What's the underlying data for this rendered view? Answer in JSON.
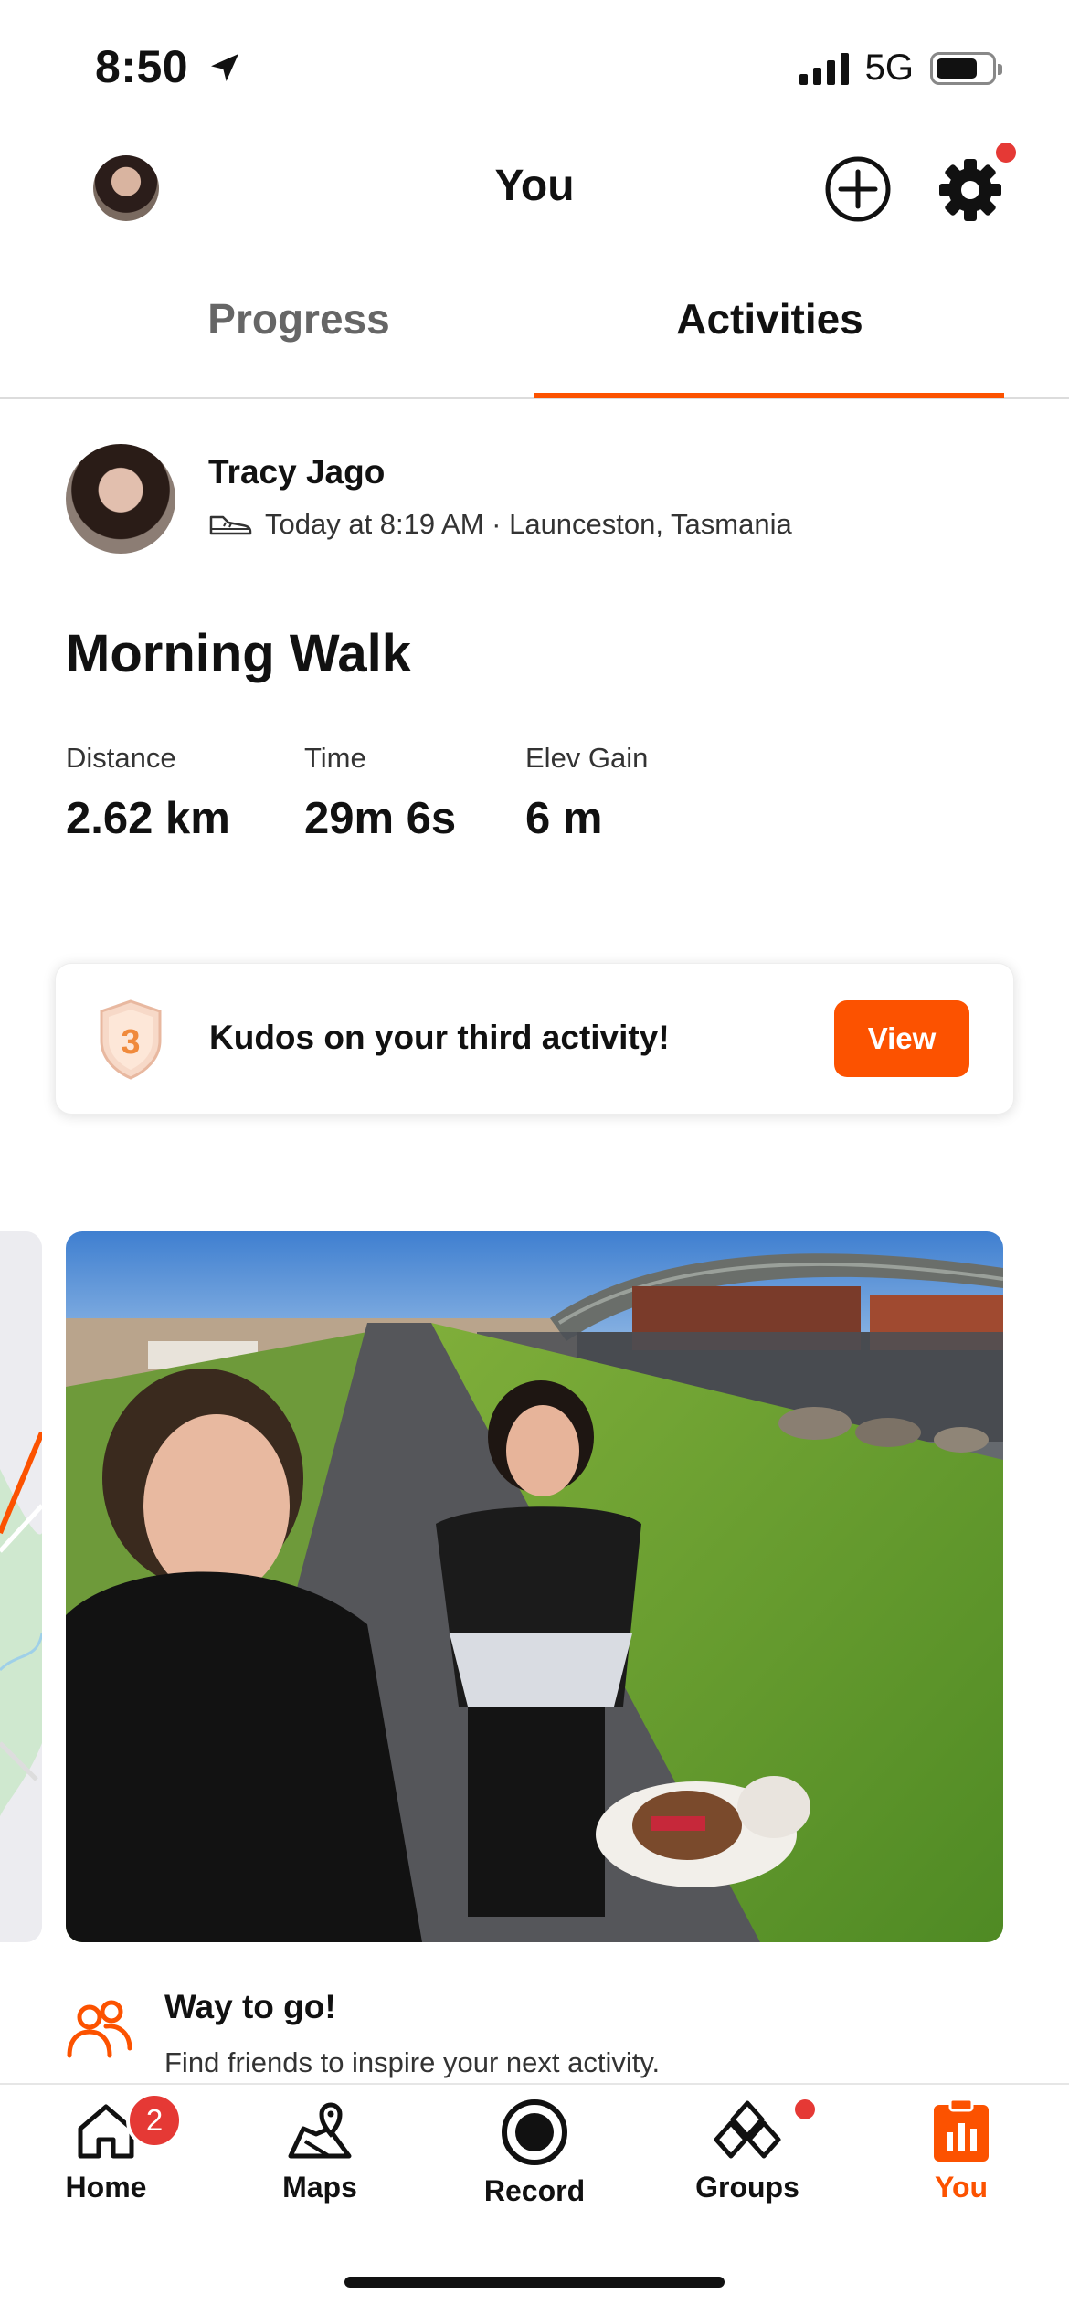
{
  "status_bar": {
    "time": "8:50",
    "network": "5G"
  },
  "header": {
    "title": "You"
  },
  "tabs": [
    {
      "label": "Progress",
      "active": false
    },
    {
      "label": "Activities",
      "active": true
    }
  ],
  "activity": {
    "athlete": "Tracy Jago",
    "meta": "Today at 8:19 AM · Launceston, Tasmania",
    "sport_icon": "shoe-icon",
    "title": "Morning Walk",
    "stats": [
      {
        "label": "Distance",
        "value": "2.62 km"
      },
      {
        "label": "Time",
        "value": "29m 6s"
      },
      {
        "label": "Elev Gain",
        "value": "6 m"
      }
    ]
  },
  "kudos": {
    "badge_number": "3",
    "text": "Kudos on your third activity!",
    "button": "View"
  },
  "way_to_go": {
    "title": "Way to go!",
    "subtitle": "Find friends to inspire your next activity."
  },
  "nav": {
    "items": [
      {
        "label": "Home",
        "badge": "2"
      },
      {
        "label": "Maps"
      },
      {
        "label": "Record"
      },
      {
        "label": "Groups"
      },
      {
        "label": "You"
      }
    ]
  },
  "colors": {
    "accent": "#fc5200",
    "notification": "#e53935"
  }
}
